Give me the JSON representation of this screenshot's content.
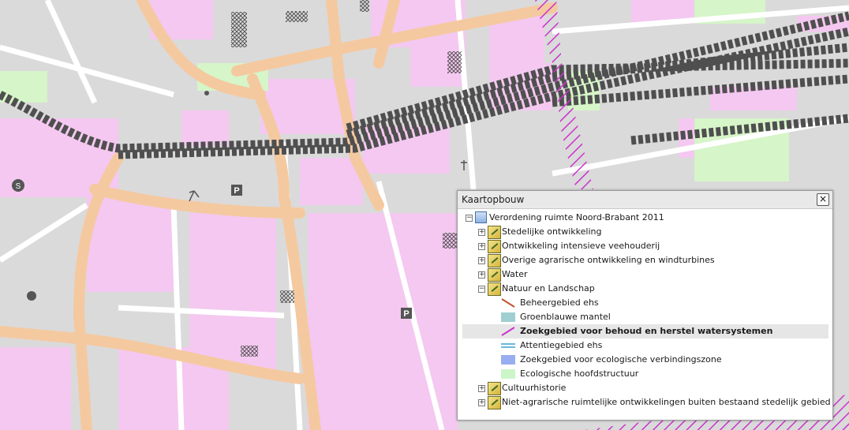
{
  "map": {
    "labels": {
      "parking_1": "P",
      "parking_2": "P",
      "station": "S"
    }
  },
  "panel": {
    "title": "Kaartopbouw",
    "close_glyph": "×",
    "root": {
      "label": "Verordening ruimte Noord-Brabant 2011",
      "expander": "−"
    },
    "groups": [
      {
        "label": "Stedelijke ontwikkeling",
        "expander": "+"
      },
      {
        "label": "Ontwikkeling intensieve veehouderij",
        "expander": "+"
      },
      {
        "label": "Overige agrarische ontwikkeling en windturbines",
        "expander": "+"
      },
      {
        "label": "Water",
        "expander": "+"
      },
      {
        "label": "Natuur en Landschap",
        "expander": "−"
      }
    ],
    "legend": [
      {
        "label": "Beheergebied ehs",
        "symbol": "diagonal-line",
        "color": "#c0522a"
      },
      {
        "label": "Groenblauwe mantel",
        "symbol": "fill",
        "color": "#9fcfd0"
      },
      {
        "label": "Zoekgebied voor behoud en herstel watersystemen",
        "symbol": "diagonal-line",
        "color": "#cc33cc",
        "selected": true
      },
      {
        "label": "Attentiegebied ehs",
        "symbol": "double-line",
        "color": "#3aa0d0"
      },
      {
        "label": "Zoekgebied voor ecologische verbindingszone",
        "symbol": "fill",
        "color": "#99aef0"
      },
      {
        "label": "Ecologische hoofdstructuur",
        "symbol": "fill",
        "color": "#ccf5c8"
      }
    ],
    "groups_after": [
      {
        "label": "Cultuurhistorie",
        "expander": "+"
      },
      {
        "label": "Niet-agrarische ruimtelijke ontwikkelingen buiten bestaand stedelijk gebied",
        "expander": "+"
      }
    ]
  },
  "colors": {
    "building_pink": "#f4c8f0",
    "land_grey": "#d8d8d8",
    "road_orange": "#f5c9a0",
    "rail_dark": "#5a5a5a",
    "green_area": "#d6f5c8",
    "hatch_magenta": "#cc33cc"
  }
}
